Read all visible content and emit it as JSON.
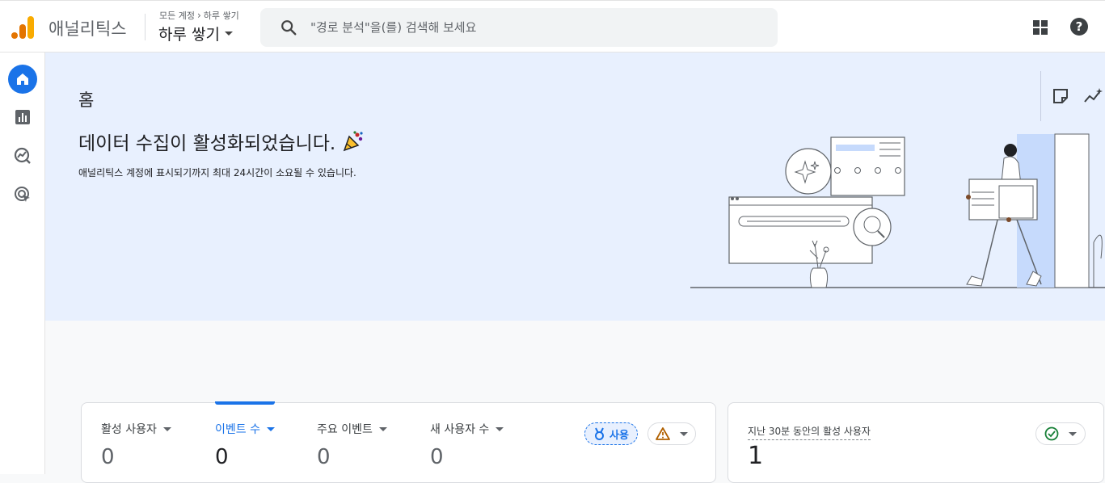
{
  "app": {
    "title": "애널리틱스"
  },
  "breadcrumb": {
    "account": "모든 계정",
    "property": "하루 쌓기"
  },
  "property_selector": {
    "label": "하루 쌓기"
  },
  "search": {
    "placeholder": "\"경로 분석\"을(를) 검색해 보세요"
  },
  "hero": {
    "page_title": "홈",
    "headline": "데이터 수집이 활성화되었습니다.",
    "subline": "애널리틱스 계정에 표시되기까지 최대 24시간이 소요될 수 있습니다."
  },
  "metrics_card": {
    "metrics": [
      {
        "label": "활성 사용자",
        "value": "0"
      },
      {
        "label": "이벤트 수",
        "value": "0"
      },
      {
        "label": "주요 이벤트",
        "value": "0"
      },
      {
        "label": "새 사용자 수",
        "value": "0"
      }
    ],
    "usage_label": "사용"
  },
  "realtime_card": {
    "label": "지난 30분 동안의 활성 사용자",
    "value": "1"
  },
  "colors": {
    "accent": "#1a73e8",
    "hero_bg": "#e8f0fe",
    "logo_orange": "#f9ab00",
    "logo_dark": "#e37400",
    "warn": "#b06000",
    "ok": "#188038"
  }
}
